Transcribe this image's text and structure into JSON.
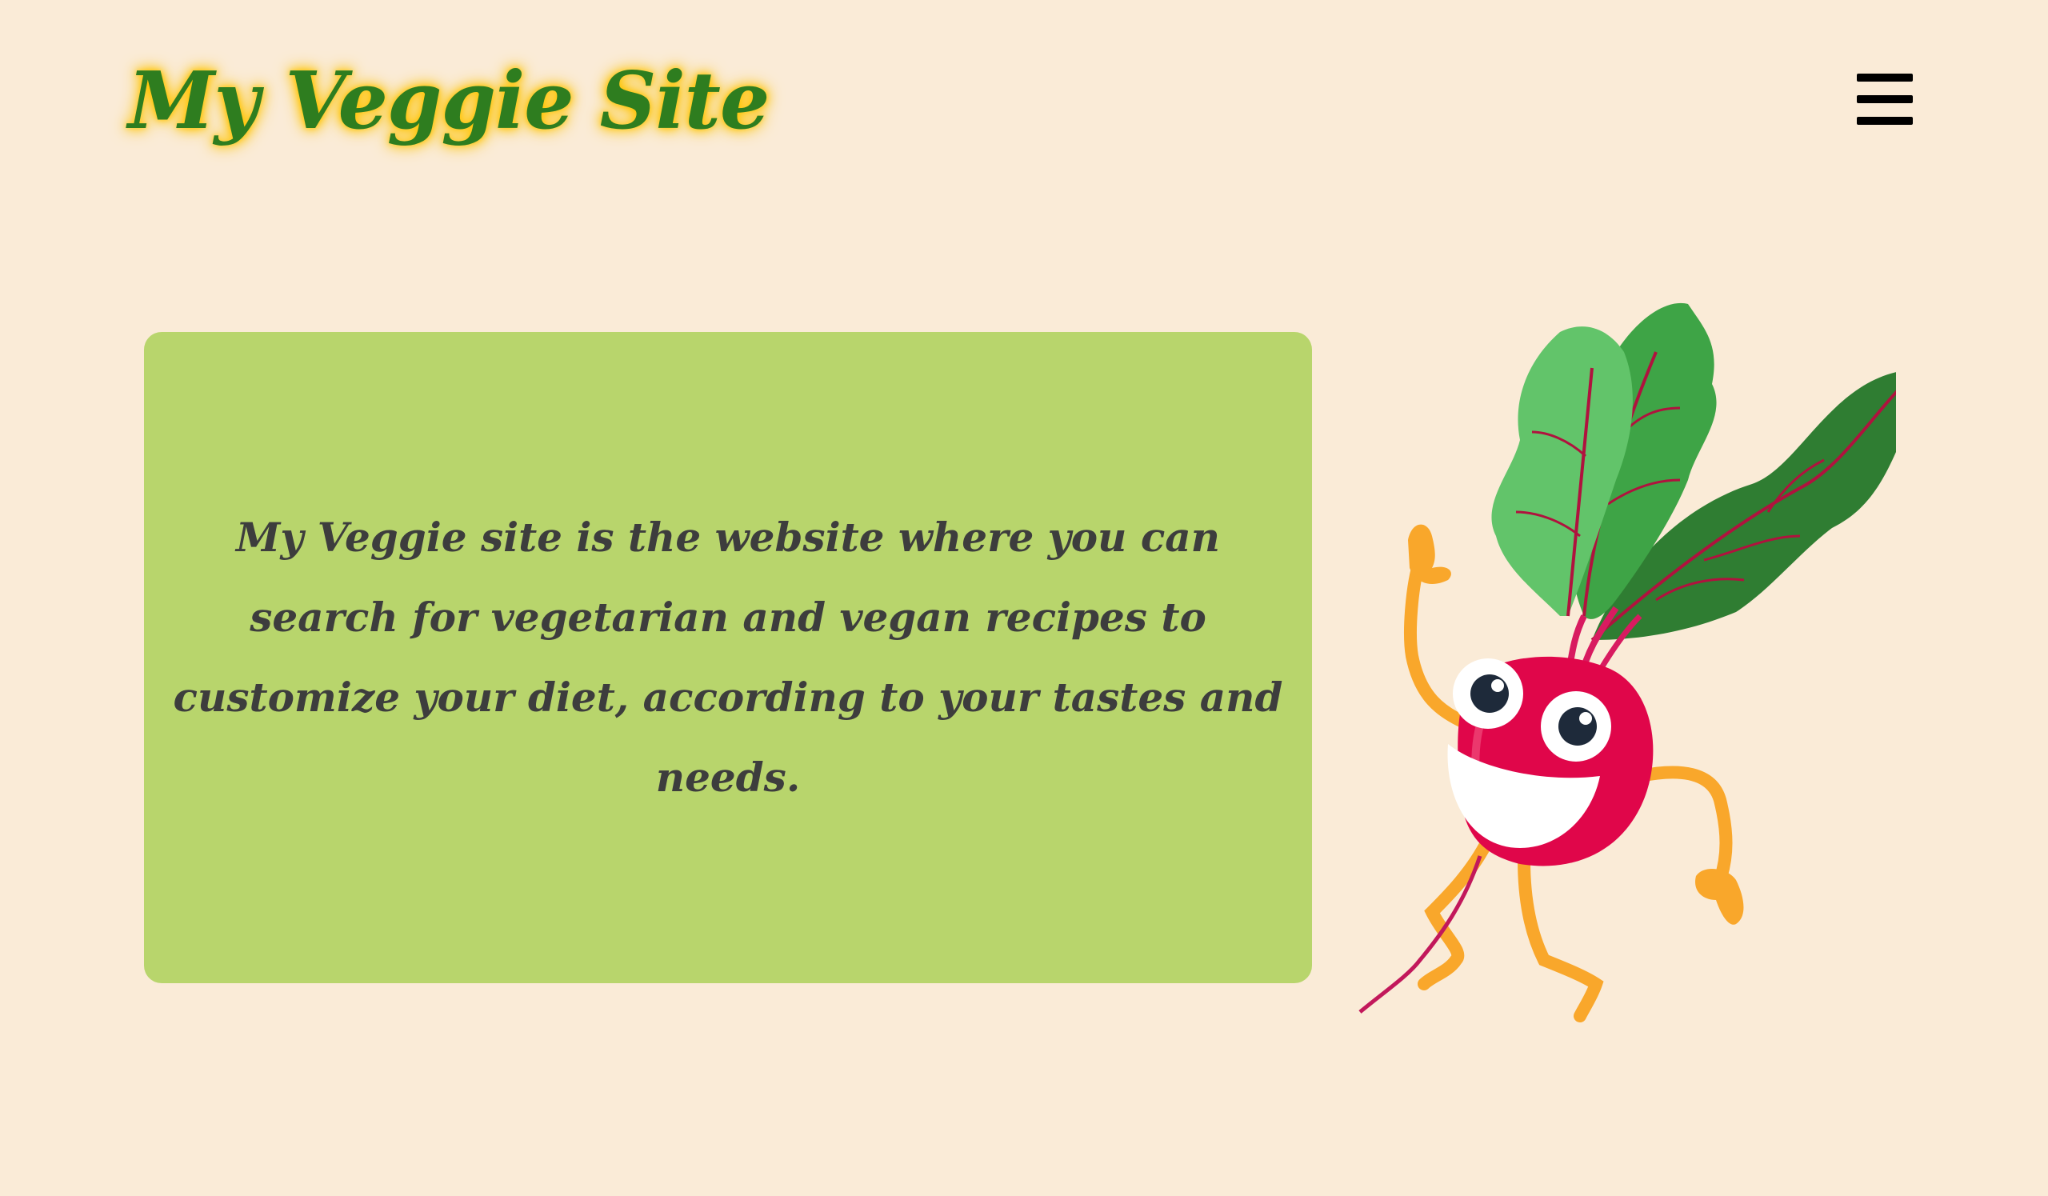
{
  "header": {
    "logo_text": "My Veggie Site",
    "menu_icon": "hamburger-menu-icon"
  },
  "intro": {
    "text": "My Veggie site is the website where you can search for vegetarian and vegan recipes to customize your diet, according to your tastes and needs."
  },
  "mascot": {
    "icon": "beet-mascot-illustration"
  },
  "colors": {
    "page_background": "#faebd7",
    "logo_green": "#2e7d1f",
    "logo_glow": "#ffc400",
    "card_background": "#b8d56c",
    "text_dark": "#3d3d3d",
    "beet_red": "#e0064a",
    "leaf_green": "#3aa04a",
    "limb_orange": "#f9a72b"
  }
}
